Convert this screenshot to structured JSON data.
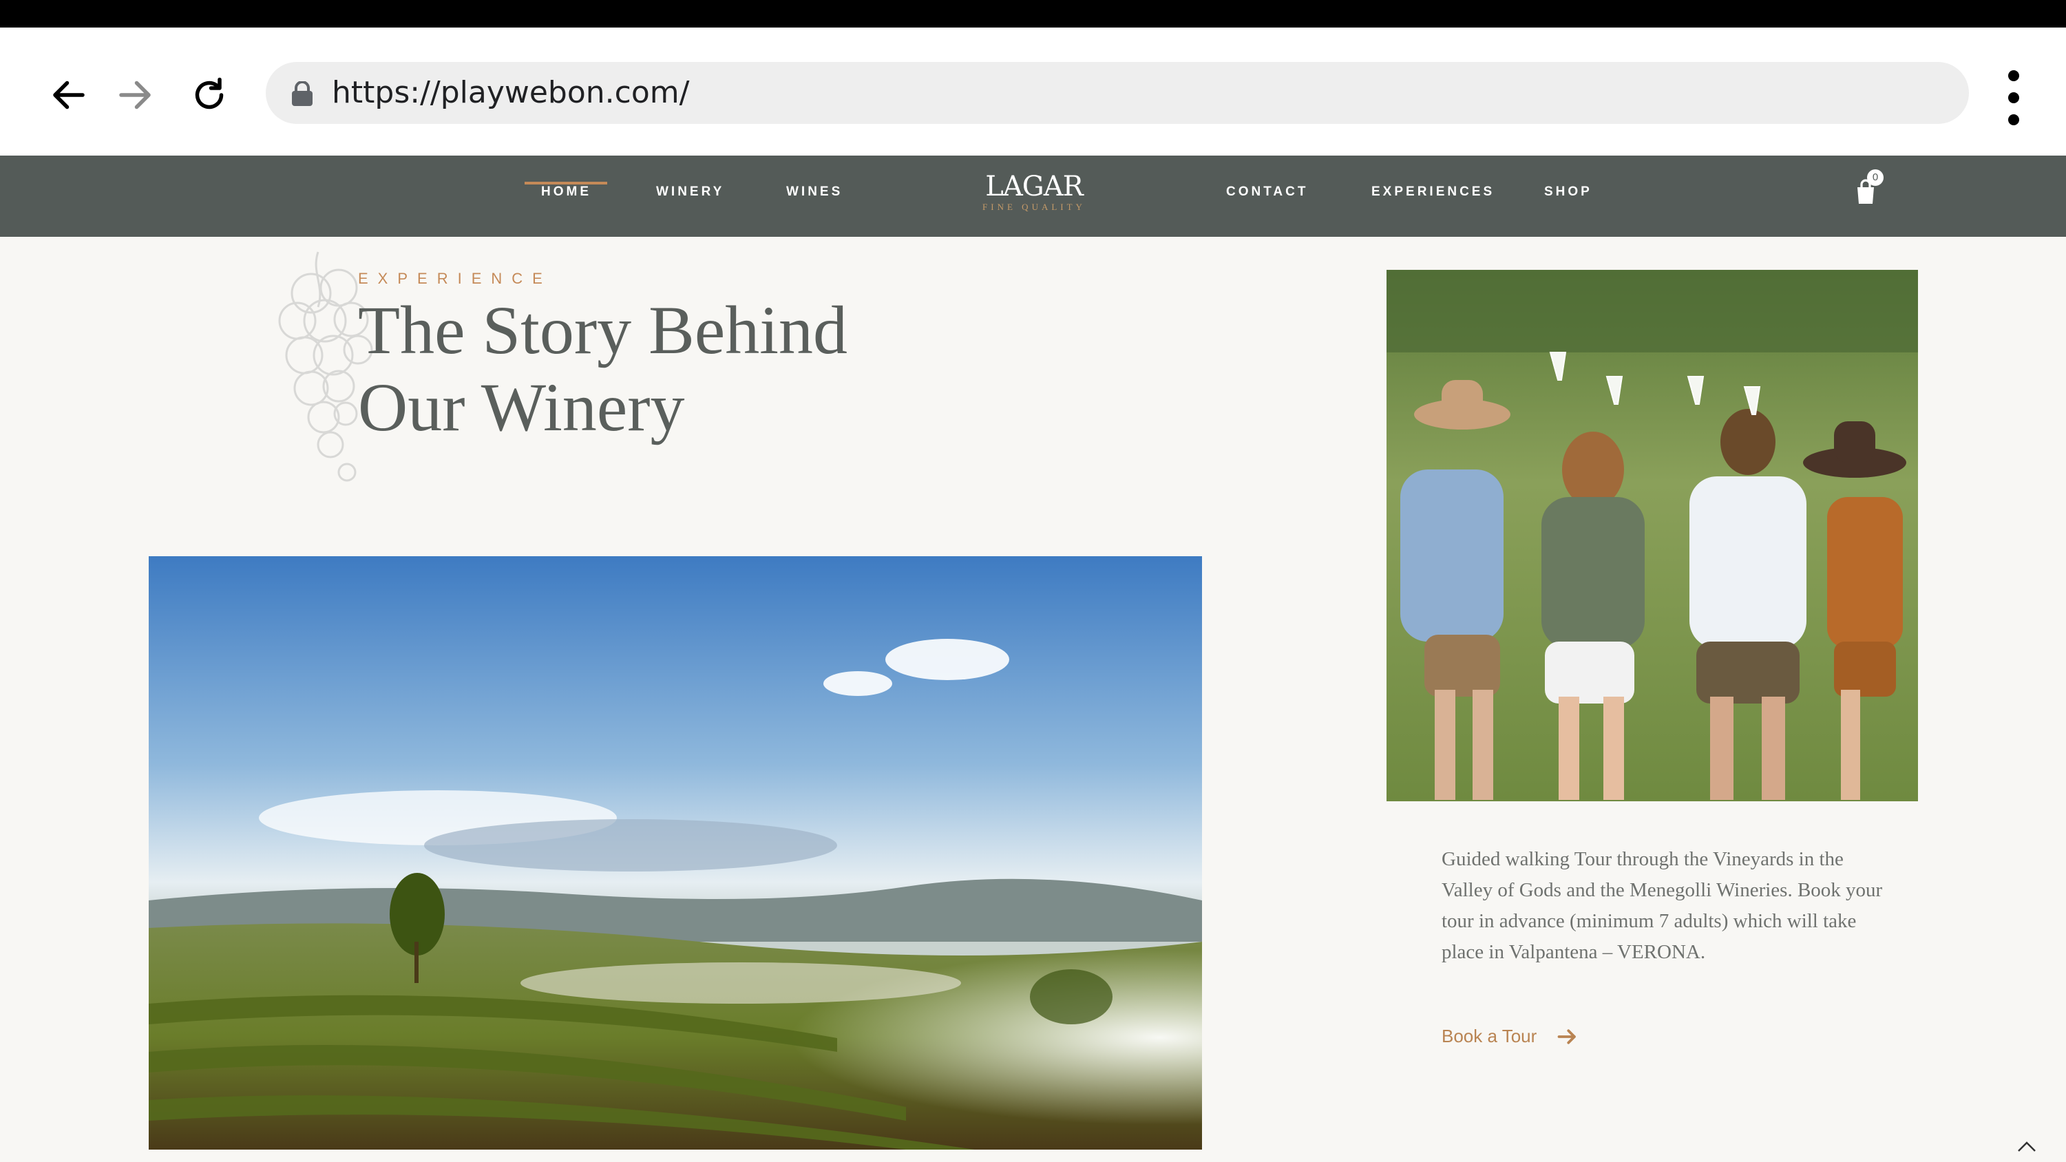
{
  "browser": {
    "url": "https://playwebon.com/",
    "back_icon": "back-arrow-icon",
    "forward_icon": "forward-arrow-icon",
    "reload_icon": "reload-icon",
    "menu_icon": "kebab-menu-icon"
  },
  "site_nav": {
    "items_left": [
      {
        "label": "HOME",
        "active": true
      },
      {
        "label": "WINERY"
      },
      {
        "label": "WINES"
      }
    ],
    "logo": {
      "main": "LAGAR",
      "sub": "FINE QUALITY"
    },
    "items_right": [
      {
        "label": "CONTACT"
      },
      {
        "label": "EXPERIENCES"
      },
      {
        "label": "SHOP"
      }
    ],
    "cart_count": "0"
  },
  "hero": {
    "eyebrow": "EXPERIENCE",
    "title_line1": "The Story Behind",
    "title_line2": "Our Winery"
  },
  "tour": {
    "description": "Guided walking Tour through the Vineyards in the Valley of Gods and the Menegolli Wineries. Book your tour in advance (minimum 7 adults) which will take place in Valpantena – VERONA.",
    "cta_label": "Book a Tour"
  },
  "colors": {
    "nav_bg": "#545b58",
    "accent": "#c58a58",
    "page_bg": "#f8f7f4",
    "heading": "#5a5f5c"
  }
}
